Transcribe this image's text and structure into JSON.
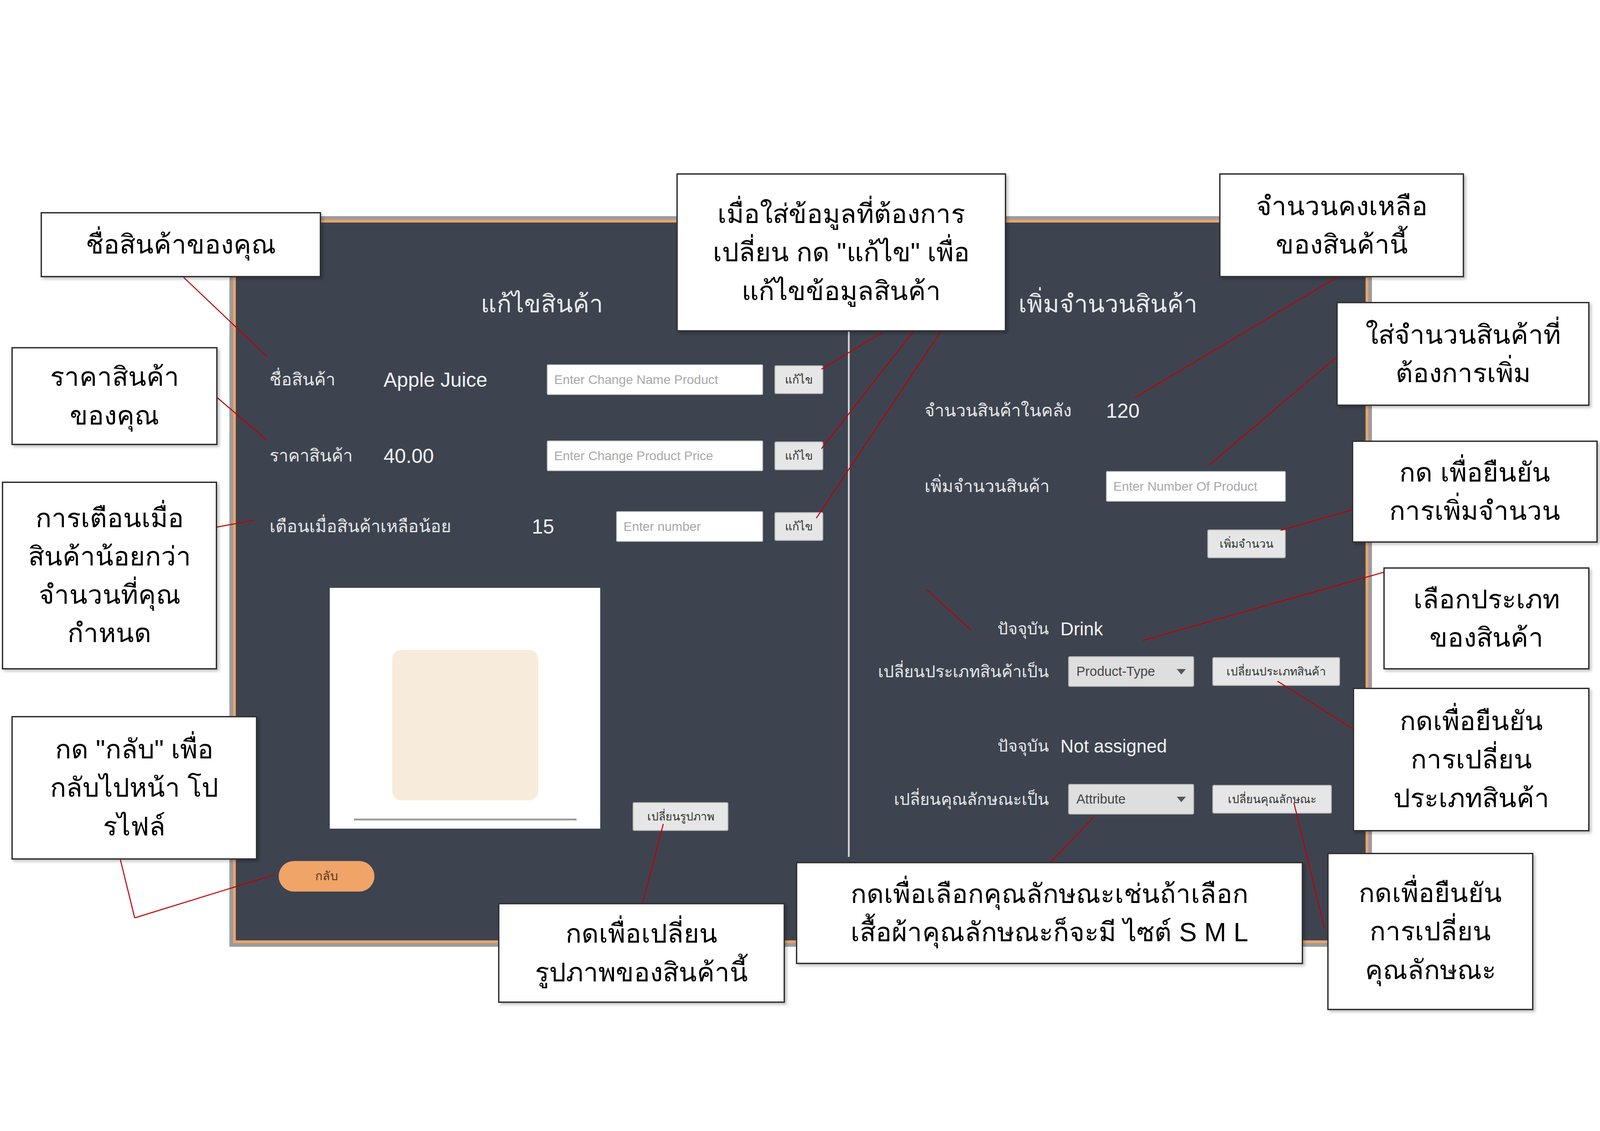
{
  "screen": {
    "edit_panel": {
      "title": "แก้ไขสินค้า",
      "fields": [
        {
          "label": "ชื่อสินค้า",
          "value": "Apple Juice",
          "placeholder": "Enter Change Name Product",
          "button": "แก้ไข"
        },
        {
          "label": "ราคาสินค้า",
          "value": "40.00",
          "placeholder": "Enter Change Product Price",
          "button": "แก้ไข"
        },
        {
          "label": "เตือนเมื่อสินค้าเหลือน้อย",
          "value": "15",
          "placeholder": "Enter number",
          "button": "แก้ไข"
        }
      ],
      "image_button": "เปลี่ยนรูปภาพ",
      "back_button": "กลับ"
    },
    "stock_panel": {
      "title": "เพิ่มจำนวนสินค้า",
      "stock_label": "จำนวนสินค้าในคลัง",
      "stock_value": "120",
      "add_label": "เพิ่มจำนวนสินค้า",
      "add_placeholder": "Enter Number Of Product",
      "add_button": "เพิ่มจำนวน",
      "selectors": [
        {
          "current_label": "ปัจจุบัน",
          "current_value": "Drink",
          "label": "เปลี่ยนประเภทสินค้าเป็น",
          "dropdown": "Product-Type",
          "button": "เปลี่ยนประเภทสินค้า"
        },
        {
          "current_label": "ปัจจุบัน",
          "current_value": "Not assigned",
          "label": "เปลี่ยนคุณลักษณะเป็น",
          "dropdown": "Attribute",
          "button": "เปลี่ยนคุณลักษณะ"
        }
      ]
    }
  },
  "callouts": [
    {
      "lines": [
        "ชื่อสินค้าของคุณ"
      ]
    },
    {
      "lines": [
        "ราคาสินค้า",
        "ของคุณ"
      ]
    },
    {
      "lines": [
        "การเตือนเมื่อ",
        "สินค้าน้อยกว่า",
        "จำนวนที่คุณ",
        "กำหนด"
      ]
    },
    {
      "lines": [
        "กด \"กลับ\" เพื่อ",
        "กลับไปหน้า โป",
        "รไฟล์"
      ]
    },
    {
      "lines": [
        "เมื่อใส่ข้อมูลที่ต้องการ",
        "เปลี่ยน กด \"แก้ไข\" เพื่อ",
        "แก้ไขข้อมูลสินค้า"
      ]
    },
    {
      "lines": [
        "จำนวนคงเหลือ",
        "ของสินค้านี้"
      ]
    },
    {
      "lines": [
        "ใส่จำนวนสินค้าที่",
        "ต้องการเพิ่ม"
      ]
    },
    {
      "lines": [
        "กด เพื่อยืนยัน",
        "การเพิ่มจำนวน"
      ]
    },
    {
      "lines": [
        "เลือกประเภท",
        "ของสินค้า"
      ]
    },
    {
      "lines": [
        "กดเพื่อยืนยัน",
        "การเปลี่ยน",
        "ประเภทสินค้า"
      ]
    },
    {
      "lines": [
        "กดเพื่อเลือกคุณลักษณะเช่นถ้าเลือก",
        "เสื้อผ้าคุณลักษณะก็จะมี ไซต์ S M L"
      ]
    },
    {
      "lines": [
        "กดเพื่อยืนยัน",
        "การเปลี่ยน",
        "คุณลักษณะ"
      ]
    },
    {
      "lines": [
        "กดเพื่อเปลี่ยน",
        "รูปภาพของสินค้านี้"
      ]
    }
  ]
}
